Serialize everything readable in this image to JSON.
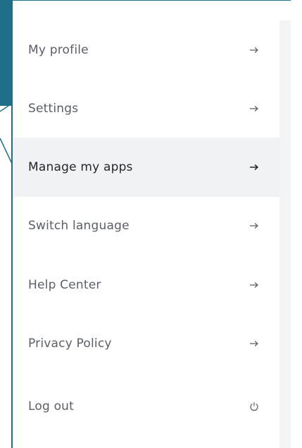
{
  "menu": {
    "items": [
      {
        "label": "My profile",
        "icon": "arrow-right-icon",
        "active": false
      },
      {
        "label": "Settings",
        "icon": "arrow-right-icon",
        "active": false
      },
      {
        "label": "Manage my apps",
        "icon": "arrow-right-icon",
        "active": true
      },
      {
        "label": "Switch language",
        "icon": "arrow-right-icon",
        "active": false
      },
      {
        "label": "Help Center",
        "icon": "arrow-right-icon",
        "active": false
      },
      {
        "label": "Privacy Policy",
        "icon": "arrow-right-icon",
        "active": false
      },
      {
        "label": "Log out",
        "icon": "power-icon",
        "active": false
      }
    ]
  },
  "colors": {
    "accent": "#1f6f8b",
    "active_row": "#f1f2f4",
    "text": "#5b5e66",
    "text_active": "#25272c"
  }
}
